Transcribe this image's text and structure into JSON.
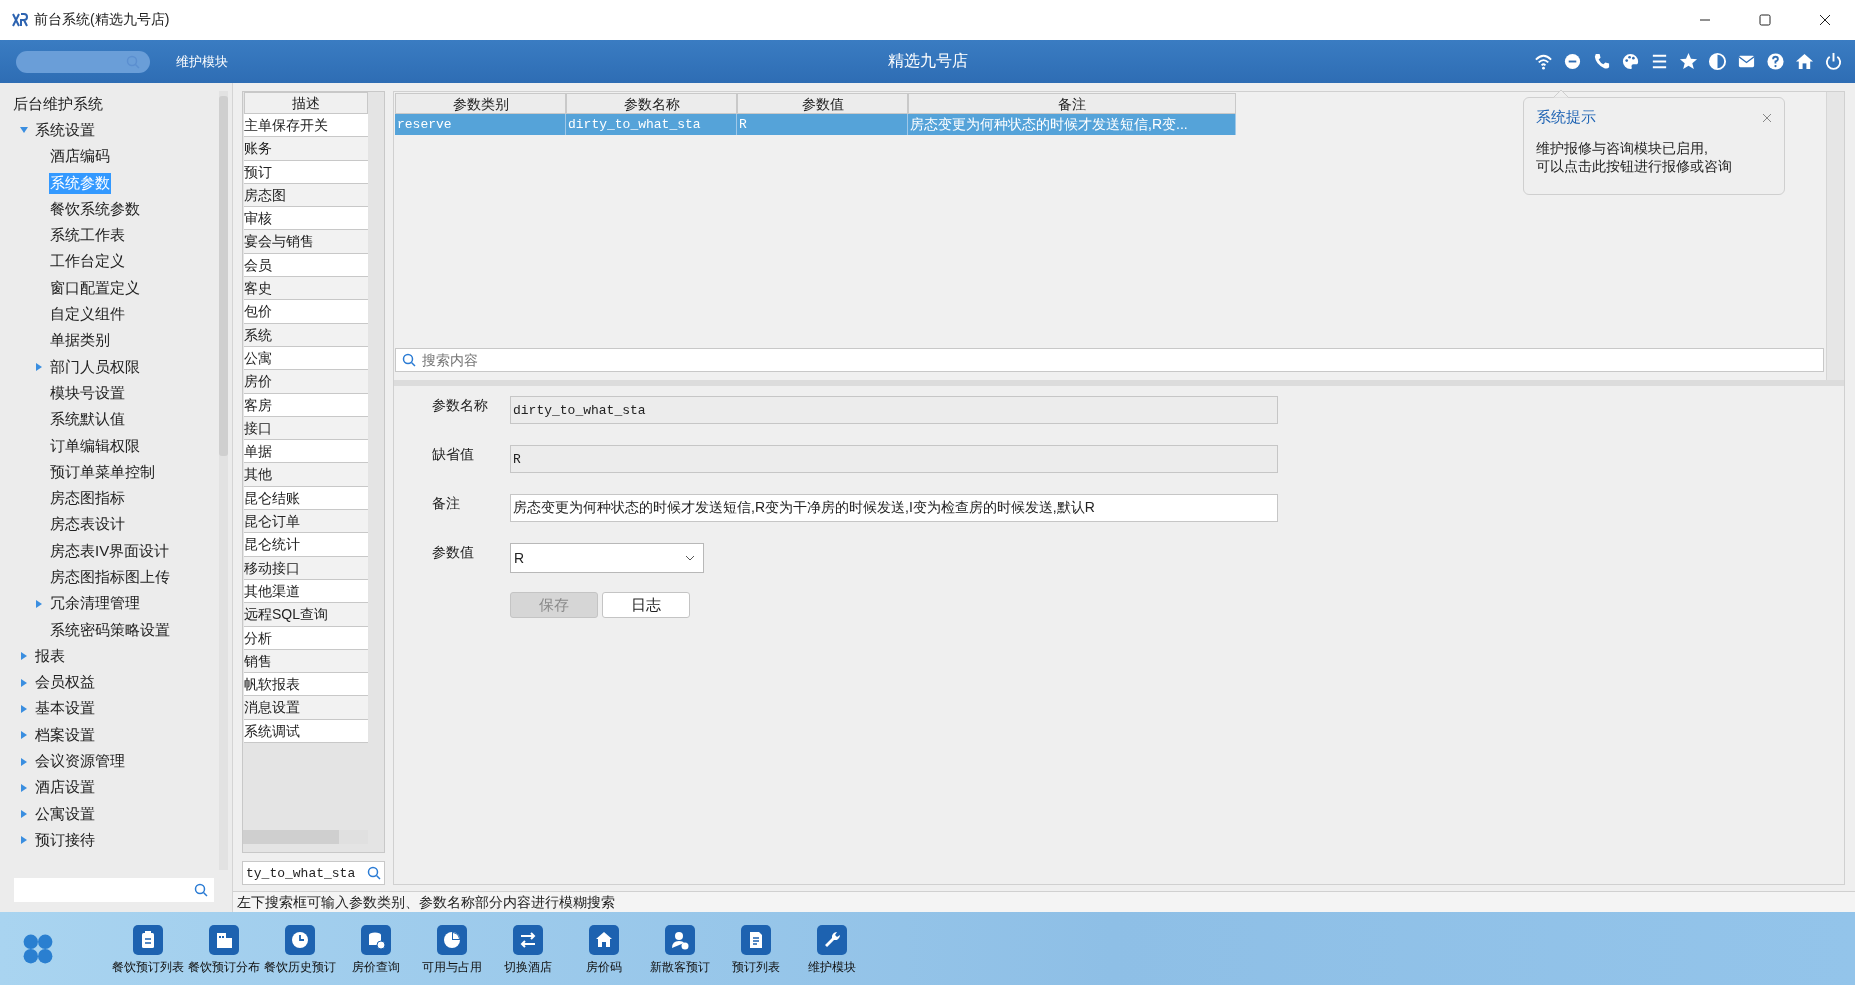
{
  "window": {
    "title": "前台系统(精选九号店)"
  },
  "header": {
    "module": "维护模块",
    "store": "精选九号店"
  },
  "tree": {
    "items": [
      {
        "label": "后台维护系统",
        "kind": "root",
        "selected": false,
        "children": [
          {
            "label": "系统设置",
            "kind": "group",
            "expanded": true,
            "selected": false,
            "children": [
              {
                "label": "酒店编码",
                "kind": "leaf",
                "selected": false
              },
              {
                "label": "系统参数",
                "kind": "leaf",
                "selected": true
              },
              {
                "label": "餐饮系统参数",
                "kind": "leaf",
                "selected": false
              },
              {
                "label": "系统工作表",
                "kind": "leaf",
                "selected": false
              },
              {
                "label": "工作台定义",
                "kind": "leaf",
                "selected": false
              },
              {
                "label": "窗口配置定义",
                "kind": "leaf",
                "selected": false
              },
              {
                "label": "自定义组件",
                "kind": "leaf",
                "selected": false
              },
              {
                "label": "单据类别",
                "kind": "leaf",
                "selected": false
              },
              {
                "label": "部门人员权限",
                "kind": "group",
                "expanded": false,
                "selected": false
              },
              {
                "label": "模块号设置",
                "kind": "leaf",
                "selected": false
              },
              {
                "label": "系统默认值",
                "kind": "leaf",
                "selected": false
              },
              {
                "label": "订单编辑权限",
                "kind": "leaf",
                "selected": false
              },
              {
                "label": "预订单菜单控制",
                "kind": "leaf",
                "selected": false
              },
              {
                "label": "房态图指标",
                "kind": "leaf",
                "selected": false
              },
              {
                "label": "房态表设计",
                "kind": "leaf",
                "selected": false
              },
              {
                "label": "房态表IV界面设计",
                "kind": "leaf",
                "selected": false
              },
              {
                "label": "房态图指标图上传",
                "kind": "leaf",
                "selected": false
              },
              {
                "label": "冗余清理管理",
                "kind": "group",
                "expanded": false,
                "selected": false
              },
              {
                "label": "系统密码策略设置",
                "kind": "leaf",
                "selected": false
              }
            ]
          },
          {
            "label": "报表",
            "kind": "group",
            "expanded": false,
            "selected": false
          },
          {
            "label": "会员权益",
            "kind": "group",
            "expanded": false,
            "selected": false
          },
          {
            "label": "基本设置",
            "kind": "group",
            "expanded": false,
            "selected": false
          },
          {
            "label": "档案设置",
            "kind": "group",
            "expanded": false,
            "selected": false
          },
          {
            "label": "会议资源管理",
            "kind": "group",
            "expanded": false,
            "selected": false
          },
          {
            "label": "酒店设置",
            "kind": "group",
            "expanded": false,
            "selected": false
          },
          {
            "label": "公寓设置",
            "kind": "group",
            "expanded": false,
            "selected": false
          },
          {
            "label": "预订接待",
            "kind": "group",
            "expanded": false,
            "selected": false
          }
        ]
      }
    ]
  },
  "category_list": {
    "heading": "描述",
    "items": [
      "主单保存开关",
      "账务",
      "预订",
      "房态图",
      "审核",
      "宴会与销售",
      "会员",
      "客史",
      "包价",
      "系统",
      "公寓",
      "房价",
      "客房",
      "接口",
      "单据",
      "其他",
      "昆仑结账",
      "昆仑订单",
      "昆仑统计",
      "移动接口",
      "其他渠道",
      "远程SQL查询",
      "分析",
      "销售",
      "帆软报表",
      "消息设置",
      "系统调试"
    ],
    "search": {
      "value": "ty_to_what_sta"
    }
  },
  "param_table": {
    "columns": [
      "参数类别",
      "参数名称",
      "参数值",
      "备注"
    ],
    "rows": [
      {
        "cells": [
          "reserve",
          "dirty_to_what_sta",
          "R",
          "房态变更为何种状态的时候才发送短信,R变..."
        ],
        "selected": true
      }
    ],
    "search": {
      "placeholder": "搜索内容"
    }
  },
  "form": {
    "fields": [
      {
        "label": "参数名称",
        "value": "dirty_to_what_sta",
        "kind": "readonly"
      },
      {
        "label": "缺省值",
        "value": "R",
        "kind": "readonly"
      },
      {
        "label": "备注",
        "value": "房态变更为何种状态的时候才发送短信,R变为干净房的时候发送,I变为检查房的时候发送,默认R",
        "kind": "text"
      },
      {
        "label": "参数值",
        "value": "R",
        "kind": "select"
      }
    ],
    "buttons": [
      {
        "label": "保存",
        "disabled": true
      },
      {
        "label": "日志",
        "disabled": false
      }
    ]
  },
  "notification": {
    "title": "系统提示",
    "lines": [
      "维护报修与咨询模块已启用,",
      "可以点击此按钮进行报修或咨询"
    ]
  },
  "status_bar": {
    "text": "左下搜索框可输入参数类别、参数名称部分内容进行模糊搜索"
  },
  "taskbar": {
    "items": [
      "餐饮预订列表",
      "餐饮预订分布",
      "餐饮历史预订",
      "房价查询",
      "可用与占用",
      "切换酒店",
      "房价码",
      "新散客预订",
      "预订列表",
      "维护模块"
    ]
  }
}
